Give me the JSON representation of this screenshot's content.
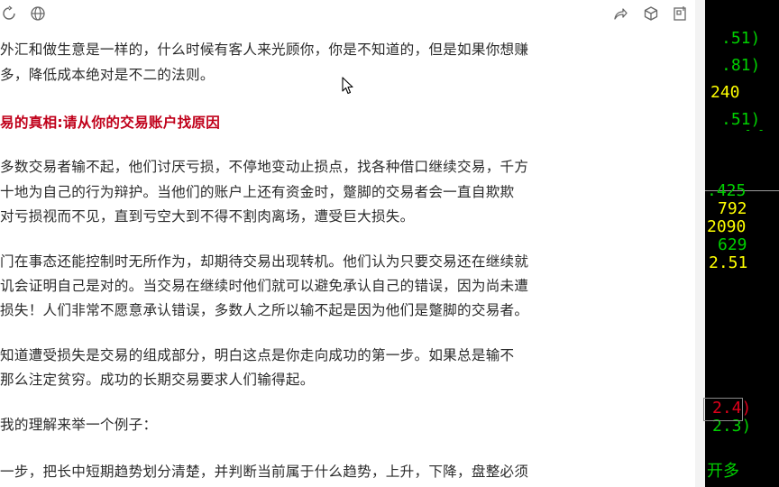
{
  "toolbar": {
    "left_icons": [
      "refresh-icon",
      "globe-icon"
    ],
    "right_icons": [
      "share-icon",
      "cube-icon",
      "sidebar-icon"
    ]
  },
  "article": {
    "paragraphs": [
      {
        "heading": false,
        "lines": [
          "外汇和做生意是一样的，什么时候有客人来光顾你，你是不知道的，但是如果你想赚",
          "多，降低成本绝对是不二的法则。"
        ]
      },
      {
        "heading": true,
        "lines": [
          "易的真相:请从你的交易账户找原因"
        ]
      },
      {
        "heading": false,
        "lines": [
          "多数交易者输不起，他们讨厌亏损，不停地变动止损点，找各种借口继续交易，千方",
          "十地为自己的行为辩护。当他们的账户上还有资金时，蹩脚的交易者会一直自欺欺",
          "   对亏损视而不见，直到亏空大到不得不割肉离场，遭受巨大损失。"
        ]
      },
      {
        "heading": false,
        "lines": [
          "门在事态还能控制时无所作为，却期待交易出现转机。他们认为只要交易还在继续就",
          "讥会证明自己是对的。当交易在继续时他们就可以避免承认自己的错误，因为尚未遭",
          "损失！人们非常不愿意承认错误，多数人之所以输不起是因为他们是蹩脚的交易者。"
        ]
      },
      {
        "heading": false,
        "lines": [
          "知道遭受损失是交易的组成部分，明白这点是你走向成功的第一步。如果总是输不",
          "   那么注定贫穷。成功的长期交易要求人们输得起。"
        ]
      },
      {
        "heading": false,
        "lines": [
          "我的理解来举一个例子："
        ]
      },
      {
        "heading": false,
        "lines": [
          "一步，把长中短期趋势划分清楚，并判断当前属于什么趋势，上升，下降，盘整必须"
        ]
      }
    ]
  },
  "terminal": {
    "quotes": [
      {
        "text": ".51)",
        "color": "green"
      },
      {
        "text": ".81)",
        "color": "green"
      },
      {
        "text": "240",
        "color": "yellow"
      },
      {
        "text": ".51)",
        "color": "green"
      },
      {
        "text": "- -",
        "color": "green"
      },
      {
        "text": ".425",
        "color": "green"
      },
      {
        "text": "792",
        "color": "yellow"
      },
      {
        "text": "2090",
        "color": "yellow"
      },
      {
        "text": "629",
        "color": "green"
      },
      {
        "text": "2.51",
        "color": "yellow"
      },
      {
        "text": "2.4)",
        "color": "red"
      },
      {
        "text": "2.3)",
        "color": "green"
      },
      {
        "text": "开多",
        "color": "green"
      }
    ]
  }
}
